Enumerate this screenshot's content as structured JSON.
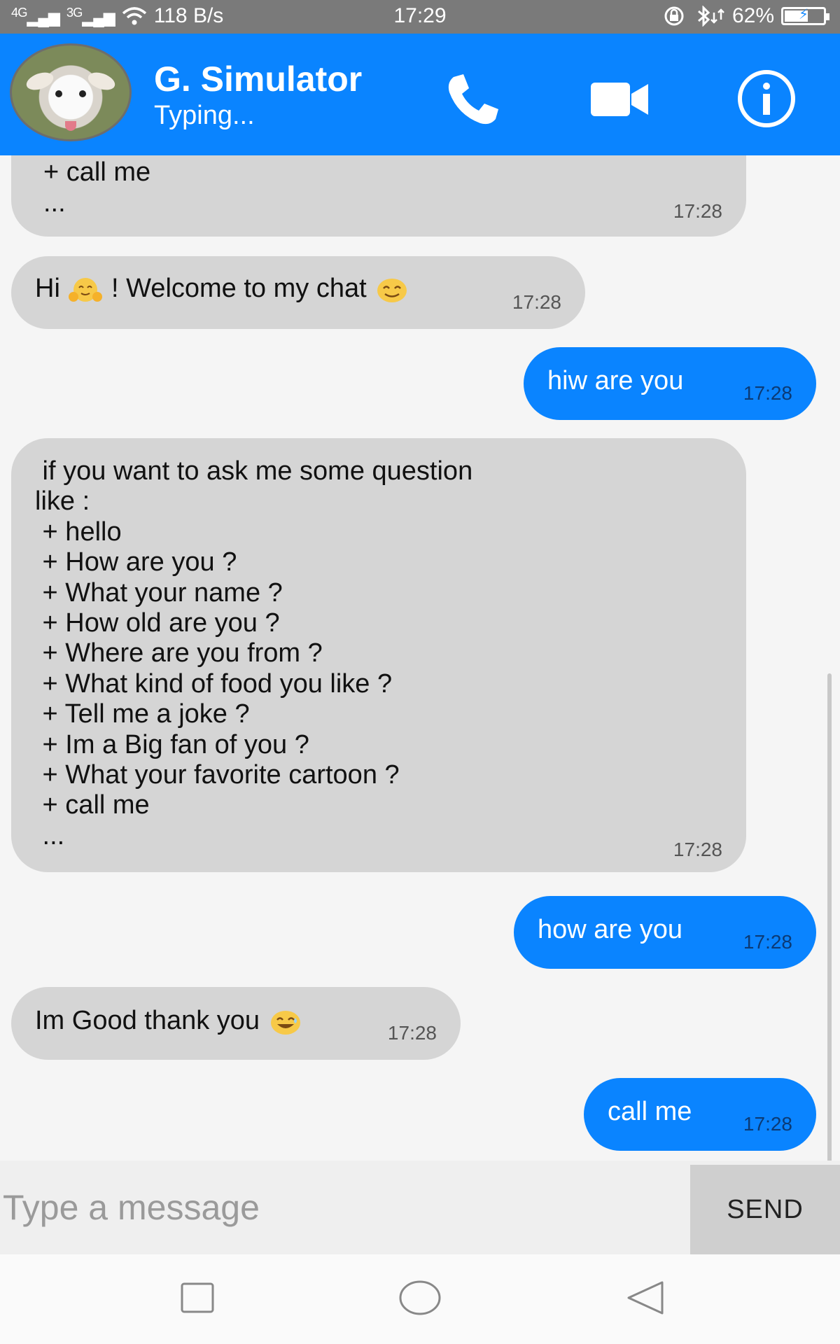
{
  "status_bar": {
    "signal_1": "4G",
    "signal_2": "3G",
    "net_speed": "118 B/s",
    "time": "17:29",
    "battery": "62%",
    "battery_level": 0.62,
    "icons": [
      "signal-icon",
      "wifi-icon",
      "rotation-lock-icon",
      "bluetooth-icon",
      "battery-icon"
    ]
  },
  "header": {
    "title": "G. Simulator",
    "status": "Typing...",
    "actions": [
      "phone-icon",
      "video-icon",
      "info-icon"
    ],
    "accent": "#0a84ff"
  },
  "messages": [
    {
      "dir": "in",
      "lines": [
        "+ call me",
        "..."
      ],
      "time": "17:28"
    },
    {
      "dir": "in",
      "text_a": "Hi",
      "text_b": "! Welcome to my chat",
      "emoji": [
        "hug-emoji",
        "smile-emoji"
      ],
      "time": "17:28"
    },
    {
      "dir": "out",
      "text": "hiw are you",
      "time": "17:28"
    },
    {
      "dir": "in",
      "text": " if you want to ask me some question\nlike :\n + hello\n + How are you ?\n + What your name ?\n + How old are you ?\n + Where are you from ?\n + What kind of food you like ?\n + Tell me a joke ?\n + Im a Big fan of you ?\n + What your favorite cartoon ?\n + call me\n ...",
      "time": "17:28"
    },
    {
      "dir": "out",
      "text": "how are you",
      "time": "17:28"
    },
    {
      "dir": "in",
      "text": "Im Good thank you",
      "emoji": [
        "laugh-emoji"
      ],
      "time": "17:28"
    },
    {
      "dir": "out",
      "text": "call me",
      "time": "17:28"
    }
  ],
  "input": {
    "placeholder": "Type a message",
    "value": ""
  },
  "send_label": "SEND",
  "navbar": [
    "square-icon",
    "circle-icon",
    "triangle-back-icon"
  ]
}
